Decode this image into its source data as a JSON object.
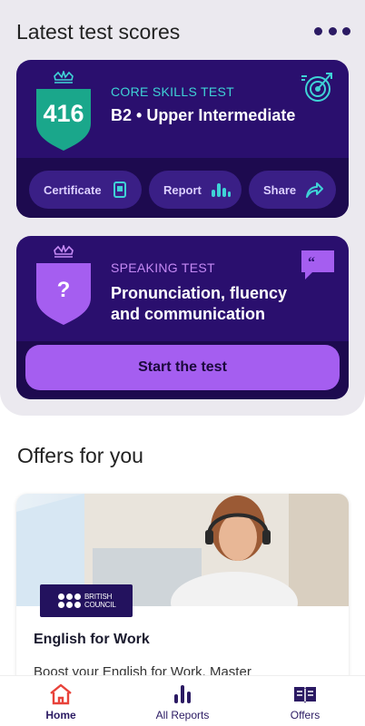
{
  "header": {
    "title": "Latest test scores",
    "more_icon": "more-horizontal-icon"
  },
  "core_test": {
    "score": "416",
    "kicker": "CORE SKILLS TEST",
    "level": "B2 • Upper Intermediate",
    "accent": "#3fd3d6",
    "shield_color": "#1aa78b",
    "actions": [
      {
        "label": "Certificate",
        "icon": "certificate-icon"
      },
      {
        "label": "Report",
        "icon": "bar-chart-icon"
      },
      {
        "label": "Share",
        "icon": "share-arrow-icon"
      }
    ]
  },
  "speaking_test": {
    "badge": "?",
    "kicker": "SPEAKING TEST",
    "title_line1": "Pronunciation, fluency",
    "title_line2": "and communication",
    "accent": "#c58af5",
    "cta": "Start the test"
  },
  "offers": {
    "title": "Offers for you",
    "card": {
      "brand_line1": "BRITISH",
      "brand_line2": "COUNCIL",
      "title": "English for Work",
      "description": "Boost your English for Work. Master"
    }
  },
  "nav": [
    {
      "label": "Home",
      "icon": "home-icon",
      "active": true
    },
    {
      "label": "All Reports",
      "icon": "reports-icon",
      "active": false
    },
    {
      "label": "Offers",
      "icon": "offers-book-icon",
      "active": false
    }
  ]
}
